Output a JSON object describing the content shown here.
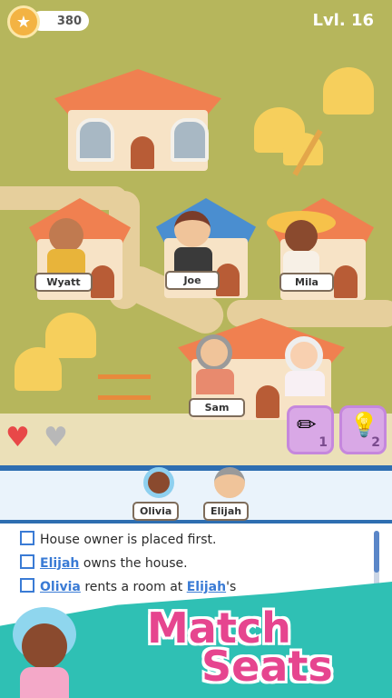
{
  "hud": {
    "coins": "380",
    "level": "Lvl. 16",
    "coin_icon": "star-icon"
  },
  "houses": [
    {
      "name": "Wyatt"
    },
    {
      "name": "Joe"
    },
    {
      "name": "Mila"
    },
    {
      "name": "Sam"
    }
  ],
  "lives": {
    "full": "♥",
    "empty": "♥"
  },
  "tools": {
    "pencil_count": "1",
    "hint_count": "2"
  },
  "queue": [
    {
      "name": "Olivia"
    },
    {
      "name": "Elijah"
    }
  ],
  "clues": [
    {
      "pre": "House owner is placed first.",
      "name1": "",
      "mid": "",
      "name2": "",
      "post": ""
    },
    {
      "pre": "",
      "name1": "Elijah",
      "mid": " owns the house.",
      "name2": "",
      "post": ""
    },
    {
      "pre": "",
      "name1": "Olivia",
      "mid": " rents a room at ",
      "name2": "Elijah",
      "post": "'s"
    }
  ],
  "promo": {
    "line1": "Match",
    "line2": "Seats"
  },
  "colors": {
    "accent": "#2e6eb1",
    "name_link": "#3a7bd5",
    "promo": "#e6458f"
  }
}
